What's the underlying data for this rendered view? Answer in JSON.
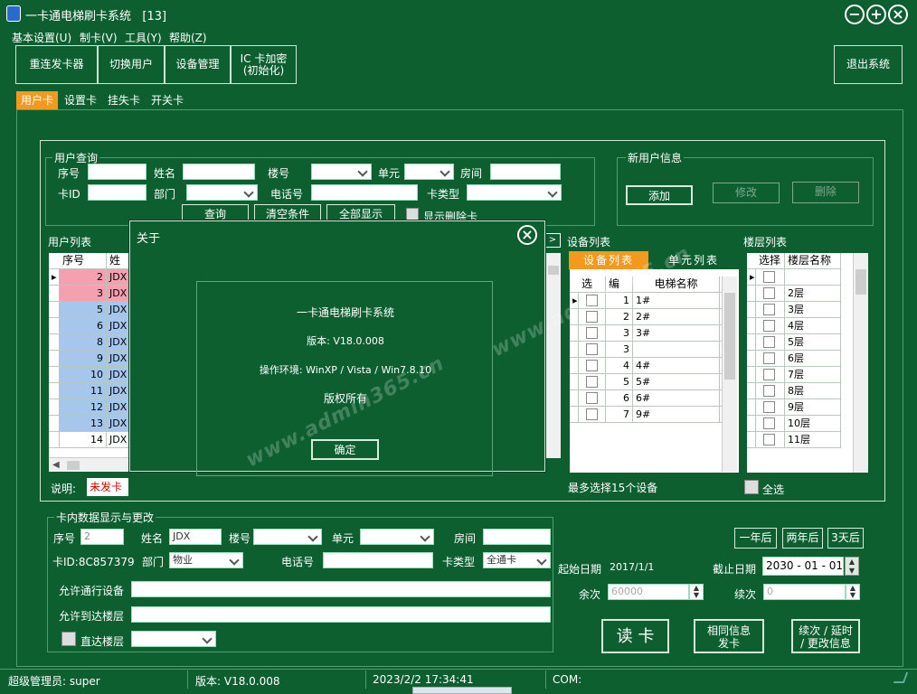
{
  "window": {
    "title": "一卡通电梯刷卡系统",
    "badge": "[13]"
  },
  "menu": [
    "基本设置(U)",
    "制卡(V)",
    "工具(Y)",
    "帮助(Z)"
  ],
  "toolbar": {
    "reconnect": "重连发卡器",
    "switch_user": "切换用户",
    "device_mgmt": "设备管理",
    "ic_encrypt_1": "IC 卡加密",
    "ic_encrypt_2": "(初始化)",
    "exit": "退出系统"
  },
  "tabs": [
    "用户卡",
    "设置卡",
    "挂失卡",
    "开关卡"
  ],
  "query": {
    "legend": "用户查询",
    "seq": "序号",
    "name": "姓名",
    "building": "楼号",
    "unit": "单元",
    "room": "房间",
    "card_id": "卡ID",
    "dept": "部门",
    "phone": "电话号",
    "card_type": "卡类型",
    "search": "查询",
    "clear": "清空条件",
    "show_all": "全部显示",
    "show_deleted": "显示删除卡"
  },
  "new_user": {
    "legend": "新用户信息",
    "add": "添加",
    "modify": "修改",
    "delete": "删除"
  },
  "user_list": {
    "title": "用户列表",
    "cols": [
      "序号",
      "姓名"
    ],
    "rows": [
      {
        "no": "2",
        "name": "JDX"
      },
      {
        "no": "3",
        "name": "JDX"
      },
      {
        "no": "5",
        "name": "JDX"
      },
      {
        "no": "6",
        "name": "JDX"
      },
      {
        "no": "8",
        "name": "JDX"
      },
      {
        "no": "9",
        "name": "JDX"
      },
      {
        "no": "10",
        "name": "JDX"
      },
      {
        "no": "11",
        "name": "JDX"
      },
      {
        "no": "12",
        "name": "JDX"
      },
      {
        "no": "13",
        "name": "JDX"
      },
      {
        "no": "14",
        "name": "JDX"
      }
    ],
    "note_label": "说明:",
    "note_value": "未发卡"
  },
  "device_list": {
    "title": "设备列表",
    "tab_device": "设备列表",
    "tab_unit": "单元列表",
    "cols": [
      "选择",
      "编码",
      "电梯名称"
    ],
    "rows": [
      {
        "code": "1",
        "name": "1#"
      },
      {
        "code": "2",
        "name": "2#"
      },
      {
        "code": "3",
        "name": "3#"
      },
      {
        "code": "3",
        "name": ""
      },
      {
        "code": "4",
        "name": "4#"
      },
      {
        "code": "5",
        "name": "5#"
      },
      {
        "code": "6",
        "name": "6#"
      },
      {
        "code": "7",
        "name": "9#"
      }
    ],
    "footer": "最多选择15个设备"
  },
  "floor_list": {
    "title": "楼层列表",
    "cols": [
      "选择",
      "楼层名称"
    ],
    "rows": [
      "",
      "2层",
      "3层",
      "4层",
      "5层",
      "6层",
      "7层",
      "8层",
      "9层",
      "10层",
      "11层"
    ],
    "select_all": "全选"
  },
  "card": {
    "legend": "卡内数据显示与更改",
    "seq": "序号",
    "seq_val": "2",
    "name": "姓名",
    "name_val": "JDX",
    "building": "楼号",
    "unit": "单元",
    "room": "房间",
    "card_id": "卡ID:8C857379",
    "dept": "部门",
    "dept_val": "物业",
    "phone": "电话号",
    "card_type": "卡类型",
    "card_type_val": "全通卡",
    "allow_dev": "允许通行设备",
    "allow_floor": "允许到达楼层",
    "direct_floor": "直达楼层",
    "one_year": "一年后",
    "two_year": "两年后",
    "three_day": "3天后",
    "start_label": "起始日期",
    "start_val": "2017/1/1",
    "end_label": "截止日期",
    "end_val": "2030 - 01 - 01",
    "remain_label": "余次",
    "remain_val": "60000",
    "renew_label": "续次",
    "renew_val": "0",
    "read": "读 卡",
    "same_info_1": "相同信息",
    "same_info_2": "发卡",
    "renew_btn_1": "续次 / 延时",
    "renew_btn_2": "/ 更改信息"
  },
  "about": {
    "title": "关于",
    "app": "一卡通电梯刷卡系统",
    "version": "版本: V18.0.008",
    "env": "操作环境: WinXP / Vista / Win7.8.10",
    "rights": "版权所有",
    "ok": "确定"
  },
  "watermark": [
    "www.admin365.cn",
    "www.admin365.cn"
  ],
  "status": {
    "admin": "超级管理员: super",
    "version": "版本: V18.0.008",
    "time": "2023/2/2 17:34:41",
    "com": "COM:"
  }
}
